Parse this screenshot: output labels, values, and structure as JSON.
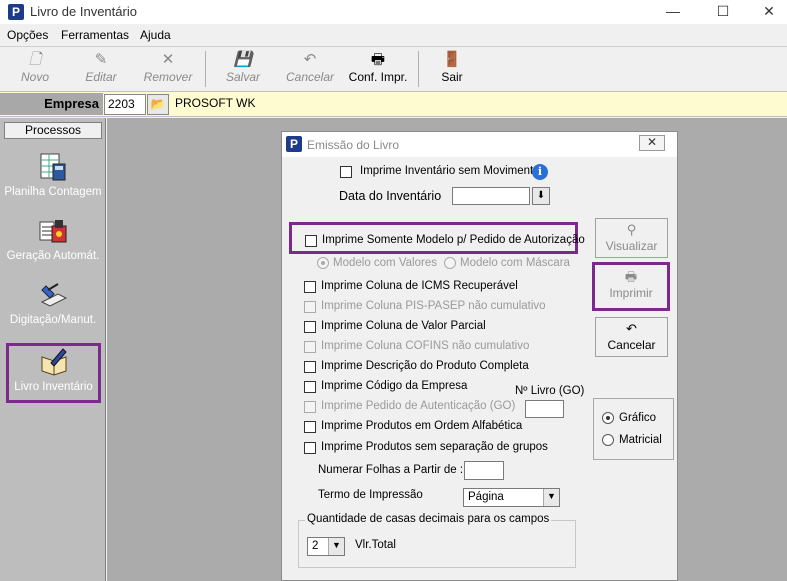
{
  "window": {
    "title": "Livro de Inventário",
    "minimize": "—",
    "maximize": "☐",
    "close": "✕"
  },
  "menu": [
    "Opções",
    "Ferramentas",
    "Ajuda"
  ],
  "toolbar": {
    "novo": "Novo",
    "editar": "Editar",
    "remover": "Remover",
    "salvar": "Salvar",
    "cancelar": "Cancelar",
    "conf_impr": "Conf. Impr.",
    "sair": "Sair"
  },
  "empresa": {
    "label": "Empresa",
    "code": "2203",
    "name": "PROSOFT WK"
  },
  "processos": {
    "header": "Processos",
    "items": [
      "Planilha Contagem",
      "Geração Automát.",
      "Digitação/Manut.",
      "Livro Inventário"
    ]
  },
  "dialog": {
    "title": "Emissão do Livro",
    "close": "✕",
    "imprime_sem_movimento": "Imprime Inventário sem Movimento",
    "data_inventario": "Data do Inventário",
    "imprime_modelo": "Imprime Somente Modelo p/ Pedido de Autorização",
    "modelo_valores": "Modelo com Valores",
    "modelo_mascara": "Modelo com Máscara",
    "options": [
      "Imprime Coluna de ICMS Recuperável",
      "Imprime Coluna PIS-PASEP não cumulativo",
      "Imprime Coluna de Valor Parcial",
      "Imprime Coluna COFINS não cumulativo",
      "Imprime Descrição do Produto Completa",
      "Imprime Código da Empresa",
      "Imprime Pedido de Autenticação (GO)",
      "Imprime Produtos em Ordem Alfabética",
      "Imprime Produtos sem separação de grupos"
    ],
    "num_livro": "Nº Livro (GO)",
    "numerar_folhas": "Numerar Folhas a Partir de :",
    "termo_impressao": "Termo de Impressão",
    "termo_value": "Página",
    "casas_title": "Quantidade de casas decimais para os campos",
    "casas_value": "2",
    "vlr_total": "Vlr.Total",
    "visualizar": "Visualizar",
    "imprimir": "Imprimir",
    "cancelar": "Cancelar",
    "grafico": "Gráfico",
    "matricial": "Matricial"
  }
}
